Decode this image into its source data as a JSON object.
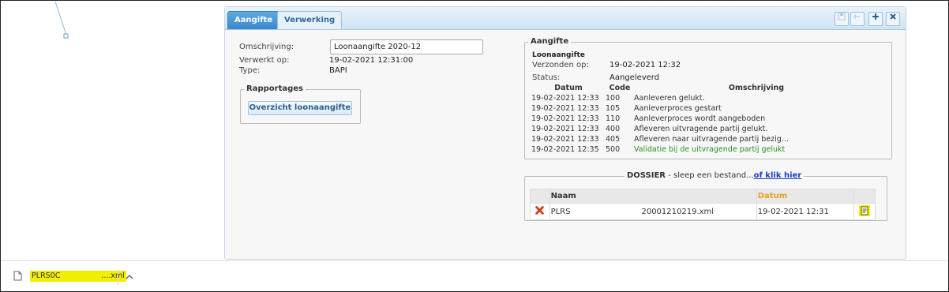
{
  "tabs": {
    "aangifte": "Aangifte",
    "verwerking": "Verwerking"
  },
  "toolbar": {
    "save_icon": "save-icon",
    "undo_icon": "undo-icon",
    "add_icon": "plus-icon",
    "close_icon": "close-icon"
  },
  "form": {
    "omschrijving_label": "Omschrijving:",
    "omschrijving_value": "Loonaangifte 2020-12",
    "verwerkt_label": "Verwerkt op:",
    "verwerkt_value": "19-02-2021 12:31:00",
    "type_label": "Type:",
    "type_value": "BAPI"
  },
  "rapportages": {
    "legend": "Rapportages",
    "button": "Overzicht loonaangifte"
  },
  "aangifte": {
    "legend": "Aangifte",
    "subtitle": "Loonaangifte",
    "verzonden_label": "Verzonden op:",
    "verzonden_value": "19-02-2021 12:32",
    "status_label": "Status:",
    "status_value": "Aangeleverd",
    "columns": [
      "Datum",
      "Code",
      "Omschrijving"
    ],
    "rows": [
      {
        "datum": "19-02-2021 12:33",
        "code": "100",
        "omschrijving": "Aanleveren gelukt."
      },
      {
        "datum": "19-02-2021 12:33",
        "code": "105",
        "omschrijving": "Aanleverproces gestart"
      },
      {
        "datum": "19-02-2021 12:33",
        "code": "110",
        "omschrijving": "Aanleverproces wordt aangeboden"
      },
      {
        "datum": "19-02-2021 12:33",
        "code": "400",
        "omschrijving": "Afleveren uitvragende partij gelukt."
      },
      {
        "datum": "19-02-2021 12:33",
        "code": "405",
        "omschrijving": "Afleveren naar uitvragende partij bezig..."
      },
      {
        "datum": "19-02-2021 12:35",
        "code": "500",
        "omschrijving": "Validatie bij de uitvragende partij gelukt"
      }
    ],
    "success_color": "#2e8b2e"
  },
  "dossier": {
    "title": "DOSSIER",
    "hint": " - sleep een bestand...",
    "link": "of klik hier",
    "col_naam": "Naam",
    "col_datum": "Datum",
    "datum_header_color": "#e8a21c",
    "file": {
      "name_prefix": "PLRS",
      "name_suffix": "20001210219.xml",
      "datum": "19-02-2021 12:31"
    }
  },
  "download": {
    "file_prefix": "PLRS0C",
    "file_suffix": "....xml",
    "chevron_icon": "chevron-up-icon",
    "file_icon": "file-icon"
  }
}
